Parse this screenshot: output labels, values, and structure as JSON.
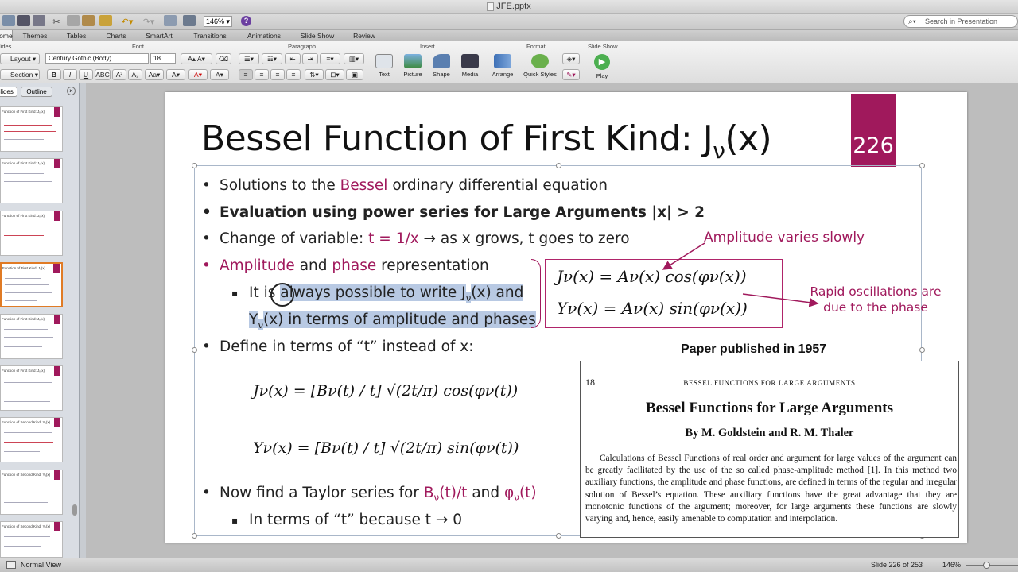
{
  "window": {
    "title": "JFE.pptx"
  },
  "toolbar": {
    "zoom": "146%",
    "search_placeholder": "Search in Presentation"
  },
  "tabs": [
    "Home",
    "Themes",
    "Tables",
    "Charts",
    "SmartArt",
    "Transitions",
    "Animations",
    "Slide Show",
    "Review"
  ],
  "ribbon": {
    "groups": {
      "slides": "Slides",
      "font": "Font",
      "paragraph": "Paragraph",
      "insert": "Insert",
      "format": "Format",
      "slideshow": "Slide Show"
    },
    "layout": "Layout",
    "section": "Section",
    "font_name": "Century Gothic (Body)",
    "font_size": "18",
    "insert_buttons": [
      "Text",
      "Picture",
      "Shape",
      "Media"
    ],
    "format_buttons": [
      "Arrange",
      "Quick Styles"
    ],
    "play": "Play"
  },
  "pane": {
    "tabs": [
      "Slides",
      "Outline"
    ],
    "thumbnails": [
      "Function of First Kind: Jᵥ(x)",
      "Function of First Kind: Jᵥ(x)",
      "Function of First Kind: Jᵥ(x)",
      "Function of First Kind: Jᵥ(x)",
      "Function of First Kind: Jᵥ(x)",
      "Function of First Kind: Jᵥ(x)",
      "Function of Second Kind: Yᵥ(x)",
      "Function of Second Kind: Yᵥ(x)",
      "Function of Second Kind: Yᵥ(x)"
    ]
  },
  "slide": {
    "title_main": "Bessel Function of First Kind: J",
    "title_sub": "ν",
    "title_end": "(x)",
    "number": "226",
    "b1_a": "Solutions to the ",
    "b1_b": "Bessel",
    "b1_c": " ordinary differential equation",
    "b2": "Evaluation using power series for Large Arguments  |x| > 2",
    "b3_a": "Change of variable: ",
    "b3_b": "t = 1/x",
    "b3_c": " → as x grows, t goes to zero",
    "b4_a": "Amplitude",
    "b4_b": " and ",
    "b4_c": "phase",
    "b4_d": " representation",
    "sb1_a": "It is ",
    "sb1_b": "always possible to write J",
    "sb1_c": "ν",
    "sb1_d": "(x) and",
    "sb1_e": "Y",
    "sb1_f": "ν",
    "sb1_g": "(x) in terms of amplitude and phases",
    "b5": "Define in terms of “t” instead of x:",
    "b6_a": "Now find a Taylor series for ",
    "b6_b": "B",
    "b6_c": "ν",
    "b6_d": "(t)/t",
    "b6_e": " and ",
    "b6_f": "φ",
    "b6_g": "ν",
    "b6_h": "(t)",
    "sb2": "In terms of “t” because t → 0",
    "eq1": "Jν(x) = Aν(x) cos(φν(x))",
    "eq2": "Yν(x) = Aν(x) sin(φν(x))",
    "eq3": "Jν(x) = [Bν(t) / t] √(2t/π) cos(φν(t))",
    "eq4": "Yν(x) = [Bν(t) / t] √(2t/π) sin(φν(t))",
    "annot_amp": "Amplitude varies slowly",
    "annot_rapid": "Rapid oscillations are due to the phase",
    "paper_caption": "Paper published in 1957",
    "paper": {
      "page": "18",
      "header": "BESSEL FUNCTIONS FOR LARGE ARGUMENTS",
      "title": "Bessel Functions for Large Arguments",
      "authors": "By M. Goldstein and R. M. Thaler",
      "abstract": "Calculations of Bessel Functions of real order and argument for large values of the argument can be greatly facilitated by the use of the so called phase-amplitude method [1]. In this method two auxiliary functions, the amplitude and phase functions, are defined in terms of the regular and irregular solution of Bessel’s equation. These auxiliary functions have the great advantage that they are monotonic functions of the argument; moreover, for large arguments these functions are slowly varying and, hence, easily amenable to computation and interpolation."
    }
  },
  "status": {
    "view": "Normal View",
    "slide_pos": "Slide 226 of 253",
    "zoom": "146%"
  },
  "colors": {
    "accent": "#a0195c",
    "selection": "#b8c9e3"
  }
}
